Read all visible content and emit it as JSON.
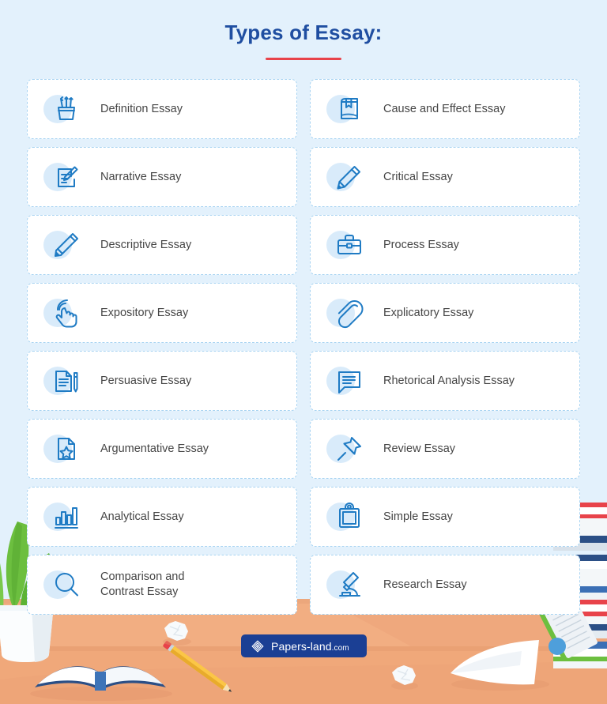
{
  "header": {
    "title": "Types of Essay:",
    "rule_color": "#e8434a",
    "title_color": "#1f4ea1"
  },
  "theme": {
    "background": "#e3f1fc",
    "card_background": "#ffffff",
    "card_border": "#a9d4f2",
    "icon_blob": "#d9ebfa",
    "icon_stroke": "#1f7bc4",
    "label_color": "#454545",
    "desk_top": "#f2ae82",
    "desk_front": "#eb9f72",
    "logo_background": "#1b3f94"
  },
  "cards": [
    {
      "label": "Definition Essay",
      "icon": "pencil-cup-icon"
    },
    {
      "label": "Cause and Effect Essay",
      "icon": "bookmarked-book-icon"
    },
    {
      "label": "Narrative Essay",
      "icon": "note-pencil-icon"
    },
    {
      "label": "Critical Essay",
      "icon": "pencil-icon"
    },
    {
      "label": "Descriptive Essay",
      "icon": "pen-icon"
    },
    {
      "label": "Process Essay",
      "icon": "briefcase-icon"
    },
    {
      "label": "Expository Essay",
      "icon": "hand-tap-icon"
    },
    {
      "label": "Explicatory Essay",
      "icon": "paperclip-icon"
    },
    {
      "label": "Persuasive Essay",
      "icon": "document-pen-icon"
    },
    {
      "label": "Rhetorical Analysis Essay",
      "icon": "speech-bubble-icon"
    },
    {
      "label": "Argumentative Essay",
      "icon": "star-document-icon"
    },
    {
      "label": "Review Essay",
      "icon": "pushpin-icon"
    },
    {
      "label": "Analytical Essay",
      "icon": "bar-chart-icon"
    },
    {
      "label": "Simple Essay",
      "icon": "clipboard-icon"
    },
    {
      "label": "Comparison and\nContrast Essay",
      "icon": "magnifier-icon"
    },
    {
      "label": "Research Essay",
      "icon": "microscope-icon"
    }
  ],
  "footer": {
    "logo_name": "Papers-land",
    "logo_tld": ".com"
  }
}
